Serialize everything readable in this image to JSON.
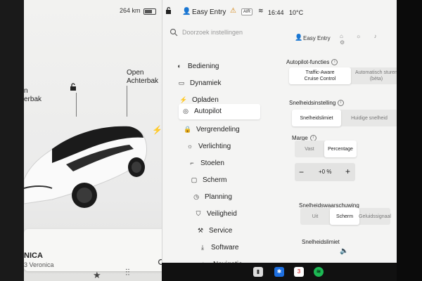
{
  "status": {
    "range": "264 km",
    "profile": "Easy Entry",
    "time": "16:44",
    "temperature": "10°C"
  },
  "car": {
    "trunk_label": "n\nerbak",
    "achterbak_label": "Open\nAchterbak",
    "card_name": "NICA",
    "card_sub": "3 Veronica"
  },
  "search": {
    "placeholder": "Doorzoek instellingen"
  },
  "profile_small": "Easy Entry",
  "nav": [
    {
      "label": "Bediening",
      "icon": "toggle-icon"
    },
    {
      "label": "Dynamiek",
      "icon": "car-icon"
    },
    {
      "label": "Opladen",
      "icon": "bolt-icon"
    },
    {
      "label": "Autopilot",
      "icon": "steering-wheel-icon",
      "active": true
    },
    {
      "label": "Vergrendeling",
      "icon": "lock-icon"
    },
    {
      "label": "Verlichting",
      "icon": "sun-icon"
    },
    {
      "label": "Stoelen",
      "icon": "seat-icon"
    },
    {
      "label": "Scherm",
      "icon": "display-icon"
    },
    {
      "label": "Planning",
      "icon": "clock-icon"
    },
    {
      "label": "Veiligheid",
      "icon": "shield-icon"
    },
    {
      "label": "Service",
      "icon": "wrench-icon"
    },
    {
      "label": "Software",
      "icon": "download-icon"
    },
    {
      "label": "Navigatie",
      "icon": "nav-icon"
    }
  ],
  "autopilot": {
    "functies_title": "Autopilot-functies",
    "functies_options": [
      "Traffic-Aware\nCruise Control",
      "Automatisch sturen (bèta)"
    ],
    "snelheid_title": "Snelheidsinstelling",
    "snelheid_options": [
      "Snelheidslimiet",
      "Huidige snelheid"
    ],
    "marge_title": "Marge",
    "marge_options": [
      "Vast",
      "Percentage"
    ],
    "marge_value": "+0 %",
    "waarschuwing_title": "Snelheidswaarschuwing",
    "waarschuwing_options": [
      "Uit",
      "Scherm",
      "Geluidssignaal"
    ],
    "limiet_title": "Snelheidslimiet"
  },
  "colors": {
    "accent": "#d27b00",
    "panel": "#f4f4f3",
    "segment_on": "#ffffff"
  }
}
